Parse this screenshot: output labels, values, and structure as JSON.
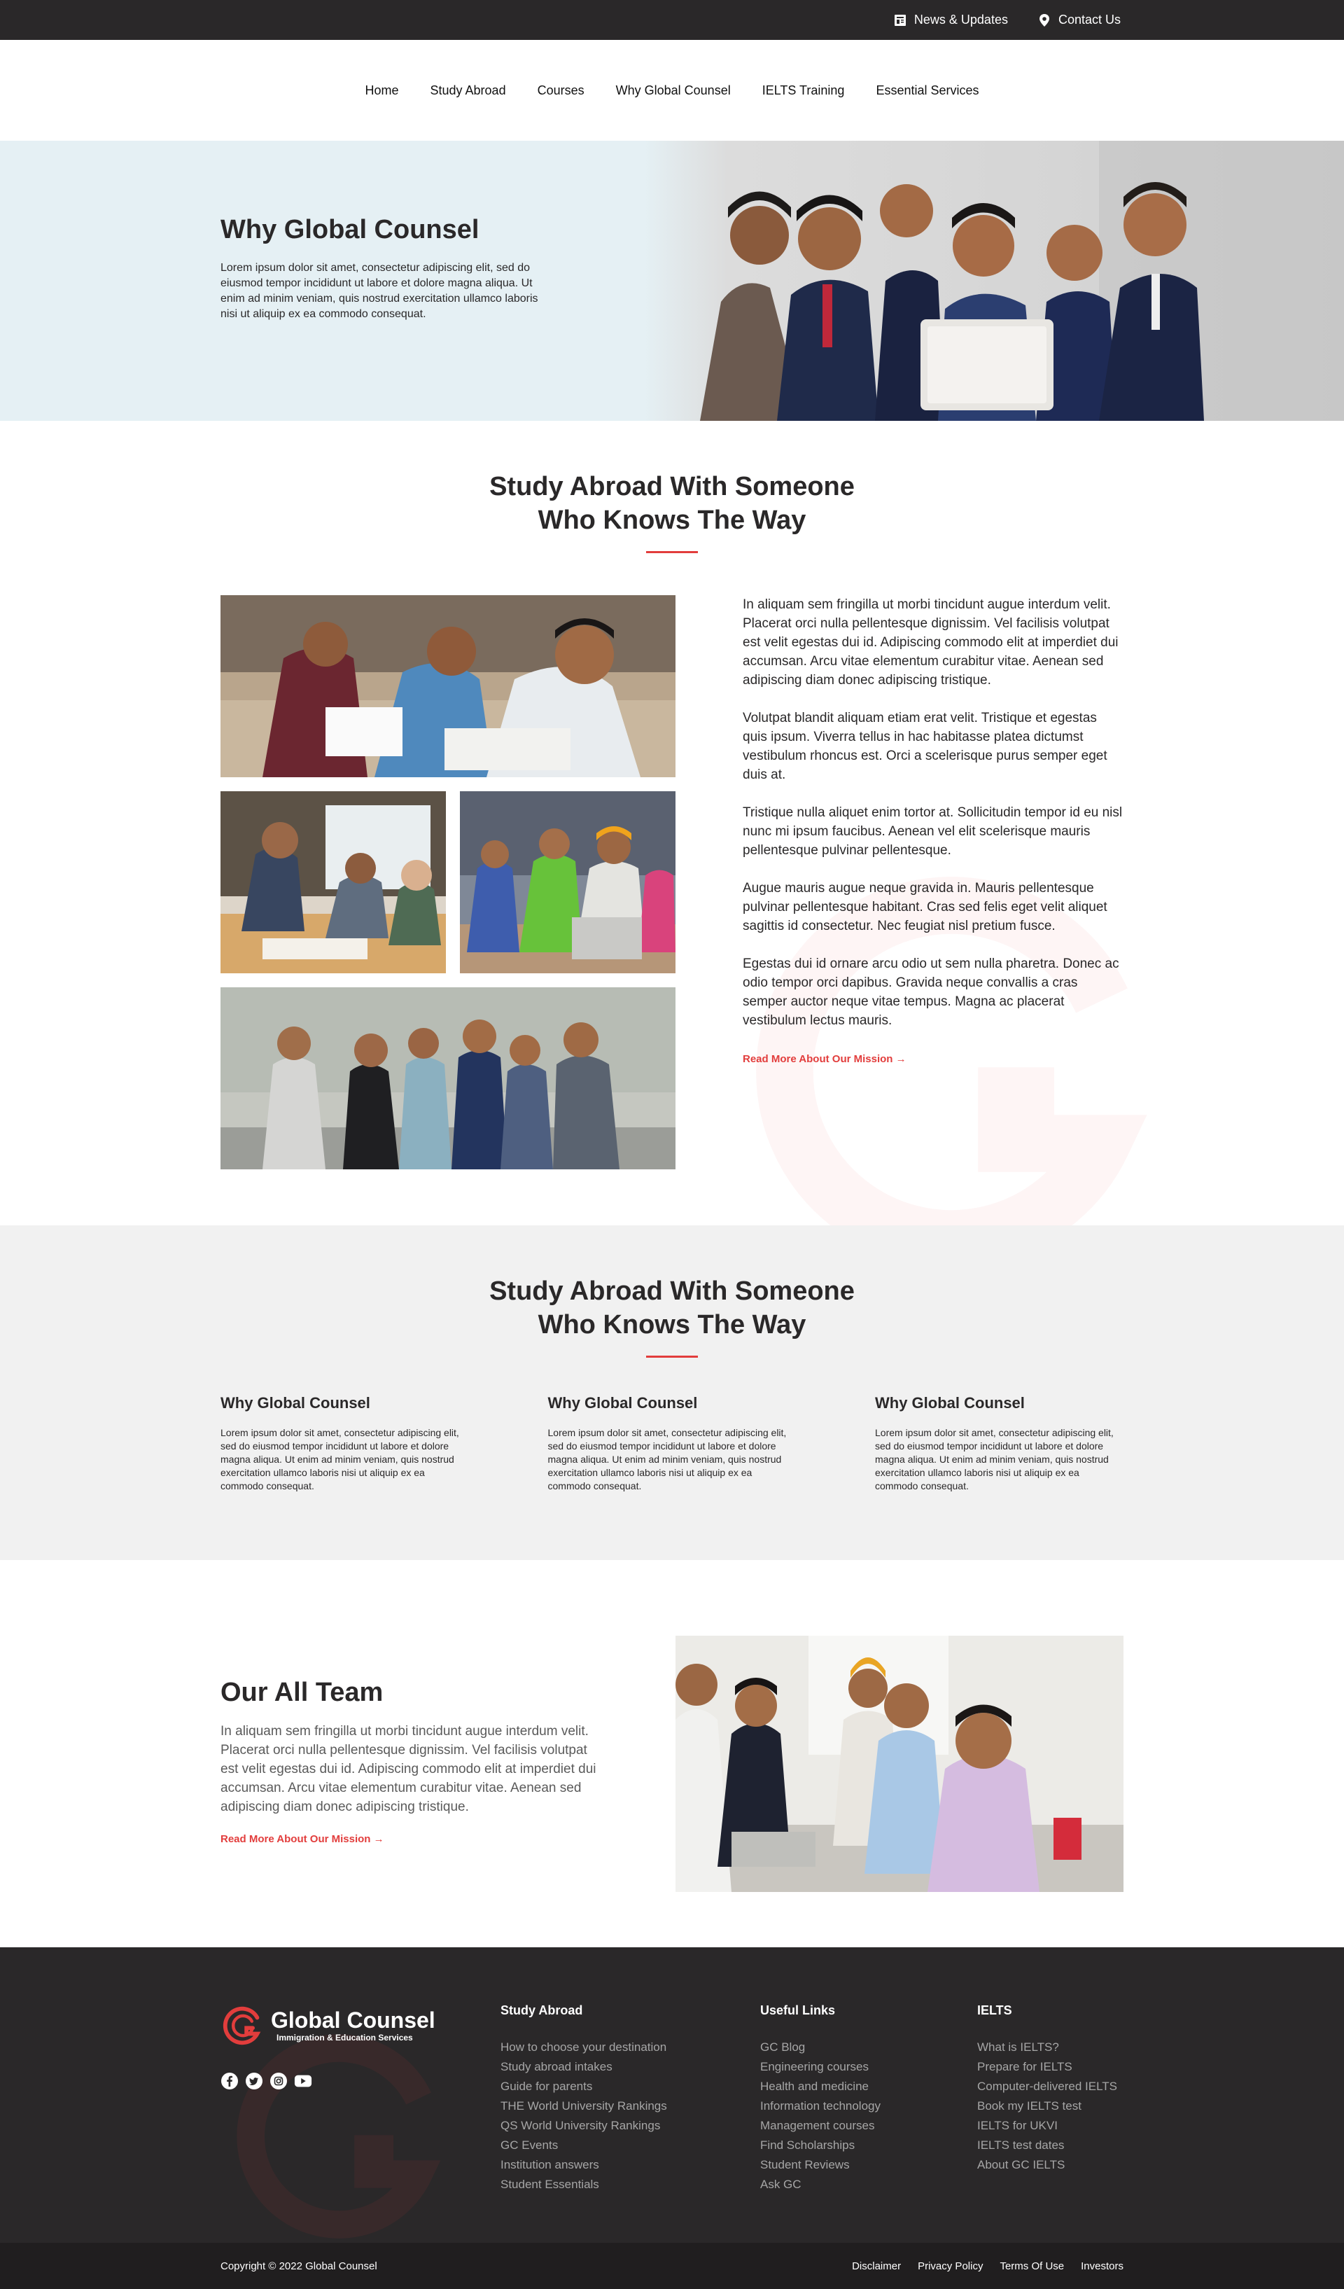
{
  "topbar": {
    "news_label": "News & Updates",
    "contact_label": "Contact Us"
  },
  "nav": {
    "items": [
      "Home",
      "Study Abroad",
      "Courses",
      "Why Global Counsel",
      "IELTS Training",
      "Essential Services"
    ]
  },
  "hero": {
    "title": "Why Global Counsel",
    "text": "Lorem ipsum dolor sit amet, consectetur adipiscing elit, sed do eiusmod tempor incididunt ut labore et dolore magna aliqua. Ut enim ad minim veniam, quis nostrud exercitation ullamco laboris nisi ut aliquip ex ea commodo consequat."
  },
  "section_intro": {
    "title_line1": "Study Abroad With Someone",
    "title_line2": "Who Knows The Way",
    "paragraphs": [
      "In aliquam sem fringilla ut morbi tincidunt augue interdum velit. Placerat orci nulla pellentesque dignissim. Vel facilisis volutpat est velit egestas dui id. Adipiscing commodo elit at imperdiet dui accumsan. Arcu vitae elementum curabitur vitae. Aenean sed adipiscing diam donec adipiscing tristique.",
      "Volutpat blandit aliquam etiam erat velit. Tristique et egestas quis ipsum. Viverra tellus in hac habitasse platea dictumst vestibulum rhoncus est. Orci a scelerisque purus semper eget duis at.",
      "Tristique nulla aliquet enim tortor at. Sollicitudin tempor id eu nisl nunc mi ipsum faucibus. Aenean vel elit scelerisque mauris pellentesque pulvinar pellentesque.",
      "Augue mauris augue neque gravida in. Mauris pellentesque pulvinar pellentesque habitant. Cras sed felis eget velit aliquet sagittis id consectetur. Nec feugiat nisl pretium fusce.",
      "Egestas dui id ornare arcu odio ut sem nulla pharetra. Donec ac odio tempor orci dapibus. Gravida neque convallis a cras semper auctor neque vitae tempus. Magna ac placerat vestibulum lectus mauris."
    ],
    "read_more": "Read More About Our Mission →"
  },
  "section_features": {
    "title_line1": "Study Abroad With Someone",
    "title_line2": "Who Knows The Way",
    "columns": [
      {
        "title": "Why Global Counsel",
        "text": "Lorem ipsum dolor sit amet, consectetur adipiscing elit, sed do eiusmod tempor incididunt ut labore et dolore magna aliqua. Ut enim ad minim veniam, quis nostrud exercitation ullamco laboris nisi ut aliquip ex ea commodo consequat."
      },
      {
        "title": "Why Global Counsel",
        "text": "Lorem ipsum dolor sit amet, consectetur adipiscing elit, sed do eiusmod tempor incididunt ut labore et dolore magna aliqua. Ut enim ad minim veniam, quis nostrud exercitation ullamco laboris nisi ut aliquip ex ea commodo consequat."
      },
      {
        "title": "Why Global Counsel",
        "text": "Lorem ipsum dolor sit amet, consectetur adipiscing elit, sed do eiusmod tempor incididunt ut labore et dolore magna aliqua. Ut enim ad minim veniam, quis nostrud exercitation ullamco laboris nisi ut aliquip ex ea commodo consequat."
      }
    ]
  },
  "team": {
    "title": "Our All Team",
    "text": "In aliquam sem fringilla ut morbi tincidunt augue interdum velit. Placerat orci nulla pellentesque dignissim. Vel facilisis volutpat est velit egestas dui id. Adipiscing commodo elit at imperdiet dui accumsan. Arcu vitae elementum curabitur vitae. Aenean sed adipiscing diam donec adipiscing tristique.",
    "read_more": "Read More About Our Mission →"
  },
  "footer": {
    "brand_name": "Global Counsel",
    "brand_tagline": "Immigration & Education Services",
    "social_icons": [
      "facebook-icon",
      "twitter-icon",
      "instagram-icon",
      "youtube-icon"
    ],
    "columns": [
      {
        "title": "Study Abroad",
        "links": [
          "How to choose your destination",
          "Study abroad intakes",
          "Guide for parents",
          "THE World University Rankings",
          "QS World University Rankings",
          "GC Events",
          "Institution answers",
          "Student Essentials"
        ]
      },
      {
        "title": "Useful Links",
        "links": [
          "GC Blog",
          "Engineering courses",
          "Health and medicine",
          "Information technology",
          "Management courses",
          "Find Scholarships",
          "Student Reviews",
          "Ask GC"
        ]
      },
      {
        "title": "IELTS",
        "links": [
          "What is IELTS?",
          "Prepare for IELTS",
          "Computer-delivered IELTS",
          "Book my IELTS test",
          "IELTS for UKVI",
          "IELTS test dates",
          "About GC IELTS"
        ]
      }
    ],
    "copyright": "Copyright © 2022 Global Counsel",
    "legal_links": [
      "Disclaimer",
      "Privacy Policy",
      "Terms Of Use",
      "Investors"
    ]
  },
  "colors": {
    "dark": "#2a2829",
    "accent": "#e23d3c",
    "hero_bg": "#e5f0f4",
    "section_bg": "#f1f1f1"
  }
}
